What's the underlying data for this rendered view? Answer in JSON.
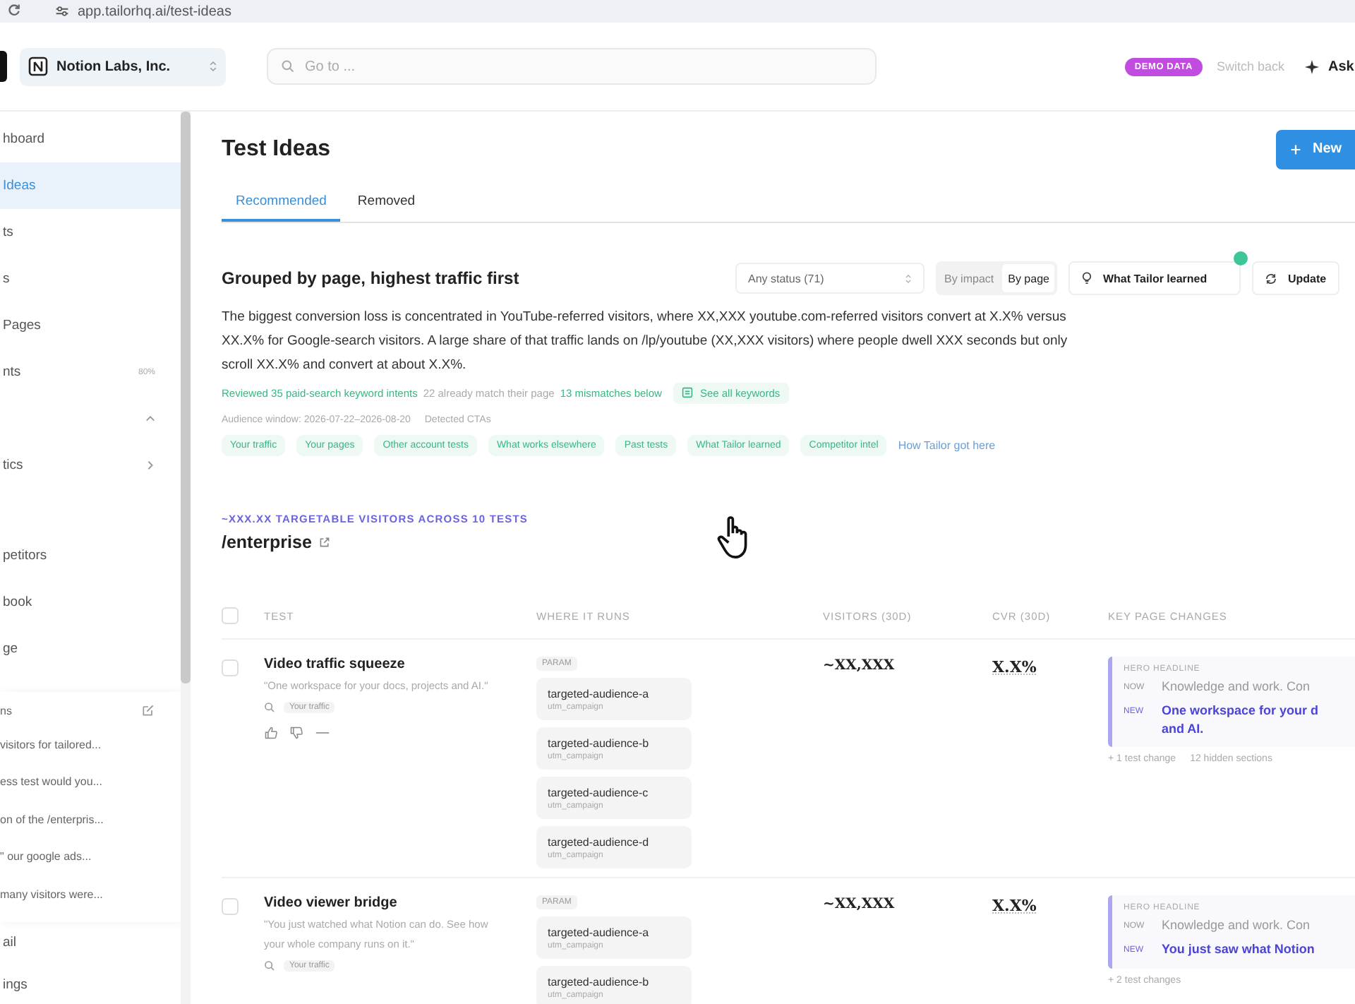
{
  "browser": {
    "url": "app.tailorhq.ai/test-ideas"
  },
  "header": {
    "org": "Notion Labs, Inc.",
    "search": {
      "placeholder": "Go to ..."
    },
    "demo_badge": "DEMO DATA",
    "switch_back": "Switch back",
    "ask": "Ask"
  },
  "sidebar": {
    "items": [
      {
        "kind": "link",
        "label": "hboard",
        "selected": false
      },
      {
        "kind": "link",
        "label": "Ideas",
        "selected": true
      },
      {
        "kind": "link",
        "label": "ts",
        "selected": false
      },
      {
        "kind": "link",
        "label": "s",
        "selected": false
      },
      {
        "kind": "link",
        "label": "Pages",
        "selected": false
      },
      {
        "kind": "link",
        "label": "nts",
        "selected": false,
        "badge": "80%"
      },
      {
        "kind": "group",
        "expanded": true
      },
      {
        "kind": "group",
        "label": "tics",
        "expanded": false
      },
      {
        "kind": "spacer"
      },
      {
        "kind": "link",
        "label": "petitors",
        "selected": false
      },
      {
        "kind": "link",
        "label": "book",
        "selected": false
      },
      {
        "kind": "link",
        "label": "ge",
        "selected": false
      }
    ],
    "chats": {
      "title": "ns",
      "items": [
        "visitors for tailored...",
        "ess test would you...",
        "on of the /enterpris...",
        "\" our google ads...",
        "many visitors were..."
      ]
    },
    "bottom_items": [
      {
        "label": "ail",
        "selected": false
      },
      {
        "label": "ings",
        "selected": false
      }
    ]
  },
  "page": {
    "title": "Test Ideas",
    "new_button": "New",
    "tabs": [
      {
        "label": "Recommended",
        "selected": true
      },
      {
        "label": "Removed",
        "selected": false
      }
    ]
  },
  "summary": {
    "heading": "Grouped by page, highest traffic first",
    "status_filter": "Any status (71)",
    "view_toggle": [
      {
        "label": "By impact",
        "selected": false
      },
      {
        "label": "By page",
        "selected": true
      }
    ],
    "learned_button": {
      "label": "What Tailor learned",
      "has_update": true
    },
    "update_button": "Update",
    "paragraph": "The biggest conversion loss is concentrated in YouTube-referred visitors, where XX,XXX youtube.com-referred visitors convert at X.X% versus XX.X% for Google-search visitors. A large share of that traffic lands on /lp/youtube (XX,XXX visitors) where people dwell XXX seconds but only scroll XX.X% and convert at about X.X%.",
    "keywords": {
      "reviewed": "Reviewed 35 paid-search keyword intents",
      "matched": "22 already match their page",
      "mismatches": "13 mismatches below",
      "link": "See all keywords"
    },
    "audience": {
      "window": "Audience window: 2026-07-22–2026-08-20",
      "ctas": "Detected CTAs"
    },
    "chips": [
      "Your traffic",
      "Your pages",
      "Other account tests",
      "What works elsewhere",
      "Past tests",
      "What Tailor learned",
      "Competitor intel"
    ],
    "how_link": "How Tailor got here"
  },
  "group": {
    "targetable": "~XXX.XX TARGETABLE VISITORS ACROSS 10 TESTS",
    "page": "/enterprise"
  },
  "table": {
    "all_checked": false,
    "columns": [
      "TEST",
      "WHERE IT RUNS",
      "VISITORS (30D)",
      "CVR (30D)",
      "KEY PAGE CHANGES"
    ],
    "rows": [
      {
        "checked": false,
        "title": "Video traffic squeeze",
        "quote": "\"One workspace for your docs, projects and AI.\"",
        "source": "Your traffic",
        "feedback": true,
        "param_label": "PARAM",
        "targets": [
          {
            "value": "targeted-audience-a",
            "param": "utm_campaign"
          },
          {
            "value": "targeted-audience-b",
            "param": "utm_campaign"
          },
          {
            "value": "targeted-audience-c",
            "param": "utm_campaign"
          },
          {
            "value": "targeted-audience-d",
            "param": "utm_campaign"
          }
        ],
        "visitors": "~XX,XXX",
        "cvr": "X.X%",
        "change": {
          "section": "HERO HEADLINE",
          "now_label": "NOW",
          "now": "Knowledge and work. Con",
          "new_label": "NEW",
          "new_lines": [
            "One workspace for your d",
            "and AI."
          ]
        },
        "more": "+ 1 test change",
        "hidden": "12 hidden sections"
      },
      {
        "checked": false,
        "title": "Video viewer bridge",
        "quote": "\"You just watched what Notion can do. See how your whole company runs on it.\"",
        "source": "Your traffic",
        "feedback": false,
        "param_label": "PARAM",
        "targets": [
          {
            "value": "targeted-audience-a",
            "param": "utm_campaign"
          },
          {
            "value": "targeted-audience-b",
            "param": "utm_campaign"
          }
        ],
        "visitors": "~XX,XXX",
        "cvr": "X.X%",
        "change": {
          "section": "HERO HEADLINE",
          "now_label": "NOW",
          "now": "Knowledge and work. Con",
          "new_label": "NEW",
          "new_lines": [
            "You just saw what Notion"
          ]
        },
        "more": "+ 2 test changes"
      }
    ]
  }
}
